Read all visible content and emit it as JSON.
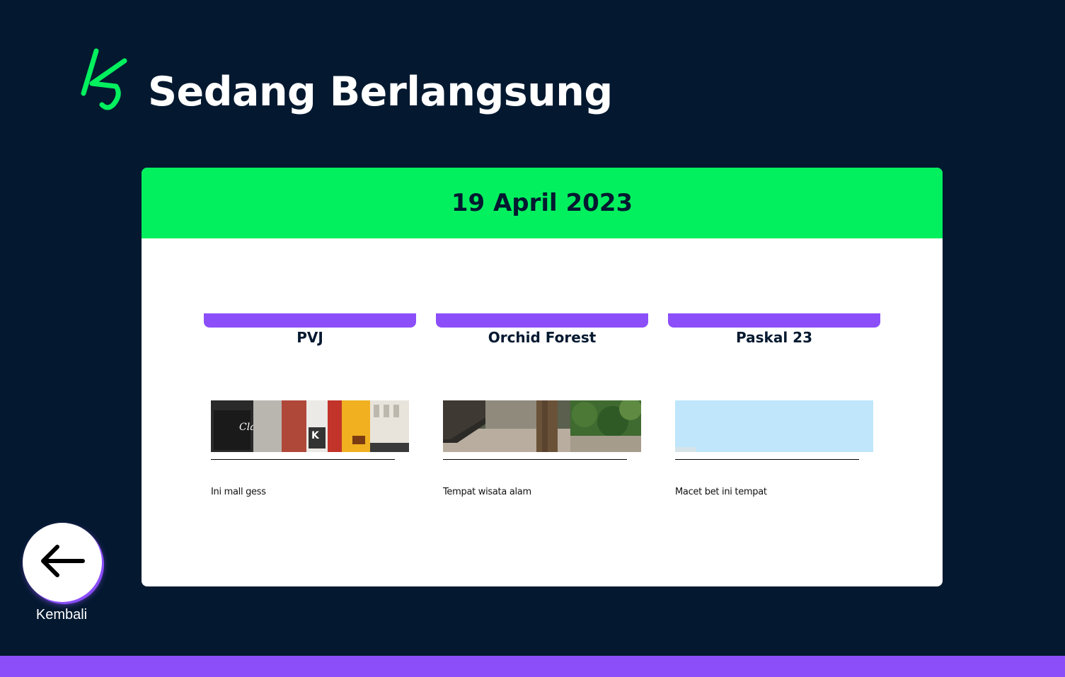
{
  "header": {
    "title": "Sedang Berlangsung",
    "logo_icon": "ks-logo-icon"
  },
  "event": {
    "date": "19 April 2023",
    "places": [
      {
        "name": "PVJ",
        "description": "Ini mall gess",
        "photo": "mall-storefront-photo"
      },
      {
        "name": "Orchid Forest",
        "description": "Tempat wisata alam",
        "photo": "forest-photo"
      },
      {
        "name": "Paskal 23",
        "description": "Macet bet ini tempat",
        "photo": "sky-photo"
      }
    ]
  },
  "nav": {
    "back_label": "Kembali",
    "back_icon": "arrow-left-icon"
  },
  "colors": {
    "background": "#041930",
    "accent_green": "#03f05e",
    "accent_purple": "#8b4ef9",
    "card": "#ffffff"
  }
}
